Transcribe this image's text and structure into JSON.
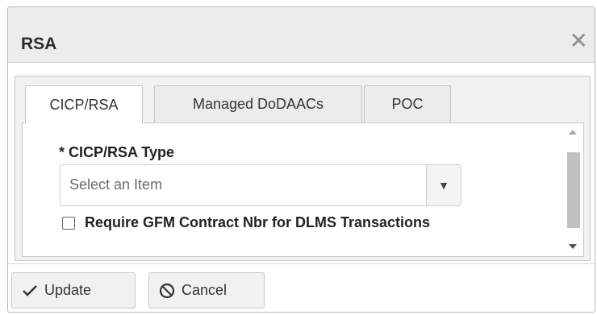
{
  "dialog": {
    "title": "RSA",
    "close_icon": "close-icon"
  },
  "tabs": [
    {
      "label": "CICP/RSA",
      "active": true
    },
    {
      "label": "Managed DoDAACs",
      "active": false
    },
    {
      "label": "POC",
      "active": false
    }
  ],
  "form": {
    "type_label": "* CICP/RSA Type",
    "type_placeholder": "Select an Item",
    "require_gfm_label": "Require GFM Contract Nbr for DLMS Transactions",
    "require_gfm_checked": false
  },
  "footer": {
    "update_label": "Update",
    "cancel_label": "Cancel"
  }
}
